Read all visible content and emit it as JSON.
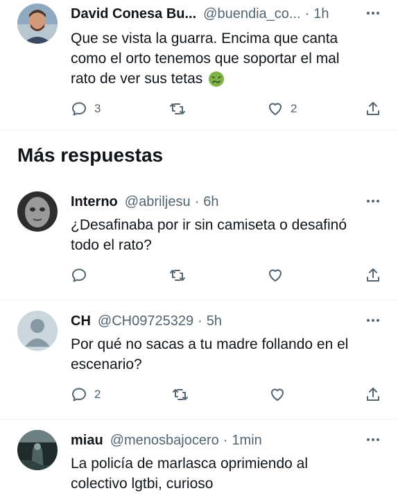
{
  "tweets": [
    {
      "name": "David Conesa Bu...",
      "handle": "@buendia_co...",
      "time": "1h",
      "lines": [
        "Que se vista la guarra. Encima que canta",
        "como el orto tenemos que soportar el mal",
        "rato de ver sus tetas"
      ],
      "emoji": "nauseated-face",
      "replies": "3",
      "retweets": "",
      "likes": "2"
    },
    {
      "name": "Interno",
      "handle": "@abriljesu",
      "time": "6h",
      "lines": [
        "¿Desafinaba por ir sin camiseta o desafinó",
        "todo el rato?"
      ],
      "replies": "",
      "retweets": "",
      "likes": ""
    },
    {
      "name": "CH",
      "handle": "@CH09725329",
      "time": "5h",
      "lines": [
        "Por qué no sacas a tu madre follando en el",
        "escenario?"
      ],
      "replies": "2",
      "retweets": "",
      "likes": ""
    },
    {
      "name": "miau",
      "handle": "@menosbajocero",
      "time": "1min",
      "lines": [
        "La policía de marlasca oprimiendo al",
        "colectivo lgtbi, curioso"
      ],
      "replies": "",
      "retweets": "",
      "likes": ""
    }
  ],
  "section_title": "Más respuestas",
  "separator": "·",
  "colors": {
    "text": "#0f1419",
    "muted": "#536471",
    "divider": "#eff3f4",
    "emoji": "#7fb34a"
  }
}
